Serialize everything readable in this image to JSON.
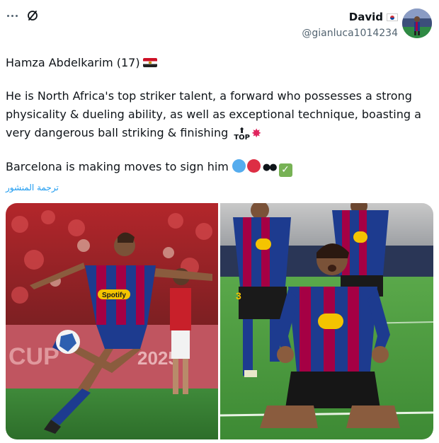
{
  "header": {
    "more_icon": "more-horizontal-icon",
    "hide_icon": "hide-circle-slash-icon"
  },
  "author": {
    "name": "David",
    "flag": "south-korea-flag-icon",
    "handle": "@gianluca1014234",
    "avatar": "profile-avatar"
  },
  "tweet": {
    "paragraph_1": "Hamza Abdelkarim (17)",
    "paragraph_1_flag": "egypt-flag-icon",
    "paragraph_2": "He is North Africa's top striker talent, a forward who possesses a strong physicality & dueling ability, as well as exceptional technique, boasting a very dangerous ball striking & finishing",
    "paragraph_2_emojis": [
      "top-arrow-icon",
      "collision-icon"
    ],
    "top_emoji_text": "TOP",
    "paragraph_3": "Barcelona is making moves to sign him",
    "paragraph_3_emojis": [
      "blue-circle-icon",
      "red-circle-icon",
      "eyes-icon",
      "check-mark-icon"
    ],
    "translate_label": "ترجمة المنشور"
  },
  "media": {
    "photo_1": {
      "banner_text": "CUP",
      "banner_year": "2025",
      "shirt_sponsor": "Spotify"
    },
    "photo_2": {
      "player_number": "3"
    }
  },
  "colors": {
    "text": "#0f1419",
    "secondary": "#536471",
    "link": "#1d9bf0",
    "barca_blue": "#1d3b8f",
    "barca_red": "#a50044"
  }
}
